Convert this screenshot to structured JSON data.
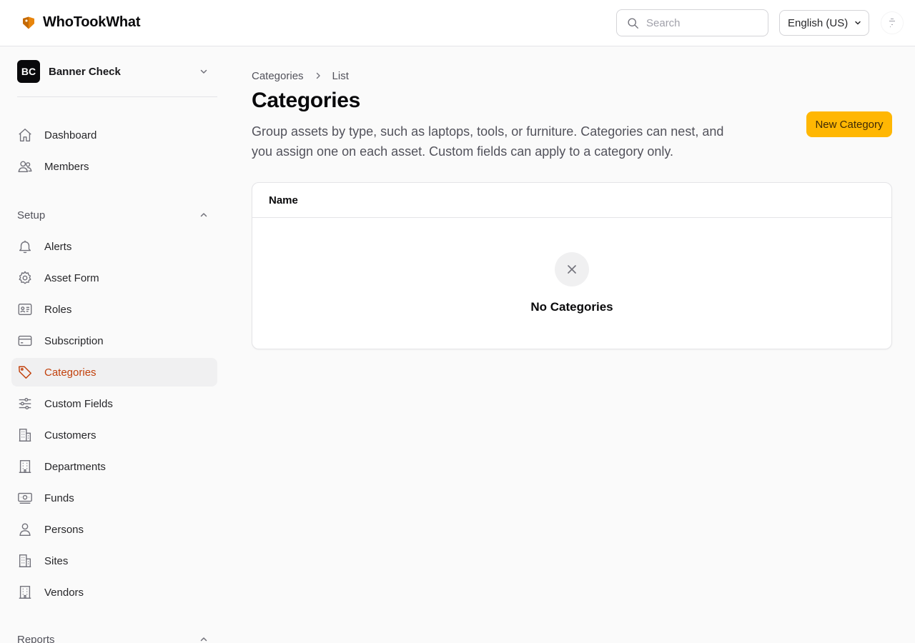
{
  "header": {
    "brand": "WhoTookWhat",
    "search_placeholder": "Search",
    "language": "English (US)"
  },
  "sidebar": {
    "org_initials": "BC",
    "org_name": "Banner Check",
    "main_items": [
      {
        "label": "Dashboard",
        "icon": "home-icon"
      },
      {
        "label": "Members",
        "icon": "users-icon"
      }
    ],
    "setup_label": "Setup",
    "setup_items": [
      {
        "label": "Alerts",
        "icon": "bell-icon"
      },
      {
        "label": "Asset Form",
        "icon": "gear-icon"
      },
      {
        "label": "Roles",
        "icon": "id-card-icon"
      },
      {
        "label": "Subscription",
        "icon": "credit-card-icon"
      },
      {
        "label": "Categories",
        "icon": "tag-icon",
        "active": true
      },
      {
        "label": "Custom Fields",
        "icon": "sliders-icon"
      },
      {
        "label": "Customers",
        "icon": "building-icon"
      },
      {
        "label": "Departments",
        "icon": "building-icon"
      },
      {
        "label": "Funds",
        "icon": "banknote-icon"
      },
      {
        "label": "Persons",
        "icon": "person-icon"
      },
      {
        "label": "Sites",
        "icon": "building-icon"
      },
      {
        "label": "Vendors",
        "icon": "building-icon"
      }
    ],
    "reports_label": "Reports"
  },
  "main": {
    "breadcrumb": [
      "Categories",
      "List"
    ],
    "title": "Categories",
    "description": "Group assets by type, such as laptops, tools, or furniture. Categories can nest, and you assign one on each asset. Custom fields can apply to a category only.",
    "new_button": "New Category",
    "table_header": "Name",
    "empty_text": "No Categories"
  },
  "colors": {
    "accent": "#ffb703",
    "active_text": "#c2410c",
    "brand_logo": "#e8850c"
  }
}
